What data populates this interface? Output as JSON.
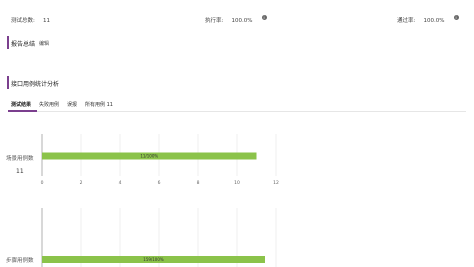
{
  "stats": {
    "total_label": "测试总数:",
    "total_value": "11",
    "exec_label": "执行率:",
    "exec_value": "100.0%",
    "pass_label": "通过率:",
    "pass_value": "100.0%"
  },
  "report": {
    "title": "报告总结",
    "edit_link": "编辑"
  },
  "analysis": {
    "title": "接口用例统计分析",
    "tabs": [
      {
        "label": "测试结果",
        "active": true
      },
      {
        "label": "失败用例",
        "active": false
      },
      {
        "label": "误报",
        "active": false
      },
      {
        "label": "所有用例 11",
        "active": false
      }
    ]
  },
  "colors": {
    "accent": "#7b3f8e",
    "bar": "#8bc34a"
  },
  "chart_data": [
    {
      "type": "bar",
      "categories": [
        "场景用例数"
      ],
      "category_count_label": "11",
      "values": [
        11
      ],
      "bar_label": "11/100%",
      "xlim": [
        0,
        12
      ],
      "xticks": [
        "0",
        "2",
        "4",
        "6",
        "8",
        "10",
        "12"
      ],
      "orientation": "horizontal",
      "grid": true
    },
    {
      "type": "bar",
      "categories": [
        "步骤用例数"
      ],
      "values": [
        159
      ],
      "bar_label": "159/100%",
      "orientation": "horizontal",
      "grid": true
    }
  ]
}
